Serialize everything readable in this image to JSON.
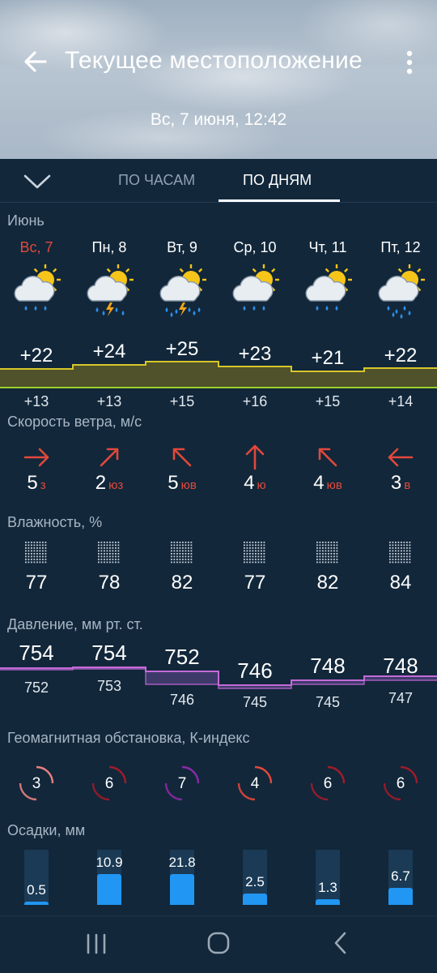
{
  "header": {
    "title": "Текущее местоположение",
    "datetime": "Вс, 7 июня, 12:42"
  },
  "tabs": {
    "hourly": "ПО ЧАСАМ",
    "daily": "ПО ДНЯМ"
  },
  "month": "Июнь",
  "days": [
    {
      "label": "Вс, 7",
      "weekend": true,
      "icon": "sun-cloud-rain-icon",
      "tmax": "+22",
      "tmin": "+13",
      "wind_speed": "5",
      "wind_dir": "з",
      "wind_icon": "arrow-right-icon",
      "humidity": "77",
      "p_max": "754",
      "p_min": "752",
      "k": "3",
      "precip": "0.5"
    },
    {
      "label": "Пн, 8",
      "weekend": false,
      "icon": "sun-cloud-thunder-icon",
      "tmax": "+24",
      "tmin": "+13",
      "wind_speed": "2",
      "wind_dir": "юз",
      "wind_icon": "arrow-up-right-icon",
      "humidity": "78",
      "p_max": "754",
      "p_min": "753",
      "k": "6",
      "precip": "10.9"
    },
    {
      "label": "Вт, 9",
      "weekend": false,
      "icon": "cloud-thunder-heavy-rain-icon",
      "tmax": "+25",
      "tmin": "+15",
      "wind_speed": "5",
      "wind_dir": "юв",
      "wind_icon": "arrow-up-left-icon",
      "humidity": "82",
      "p_max": "752",
      "p_min": "746",
      "k": "7",
      "precip": "21.8"
    },
    {
      "label": "Ср, 10",
      "weekend": false,
      "icon": "sun-cloud-rain-icon",
      "tmax": "+23",
      "tmin": "+16",
      "wind_speed": "4",
      "wind_dir": "ю",
      "wind_icon": "arrow-up-icon",
      "humidity": "77",
      "p_max": "746",
      "p_min": "745",
      "k": "4",
      "precip": "2.5"
    },
    {
      "label": "Чт, 11",
      "weekend": false,
      "icon": "sun-cloud-rain-icon",
      "tmax": "+21",
      "tmin": "+15",
      "wind_speed": "4",
      "wind_dir": "юв",
      "wind_icon": "arrow-up-left-icon",
      "humidity": "82",
      "p_max": "748",
      "p_min": "745",
      "k": "6",
      "precip": "1.3"
    },
    {
      "label": "Пт, 12",
      "weekend": false,
      "icon": "sun-cloud-heavy-rain-icon",
      "tmax": "+22",
      "tmin": "+14",
      "wind_speed": "3",
      "wind_dir": "в",
      "wind_icon": "arrow-left-icon",
      "humidity": "84",
      "p_max": "748",
      "p_min": "747",
      "k": "6",
      "precip": "6.7"
    }
  ],
  "sections": {
    "wind": "Скорость ветра, м/с",
    "humidity": "Влажность, %",
    "pressure": "Давление, мм рт. ст.",
    "geomag": "Геомагнитная обстановка, К-индекс",
    "precip": "Осадки, мм"
  },
  "colors": {
    "background": "#12273a",
    "weekend": "#e2483b",
    "wind_arrow": "#e2483b",
    "temp_band": "#b9c81e",
    "pressure_band": "#c46ad8",
    "precip_fill": "#2196f3"
  }
}
